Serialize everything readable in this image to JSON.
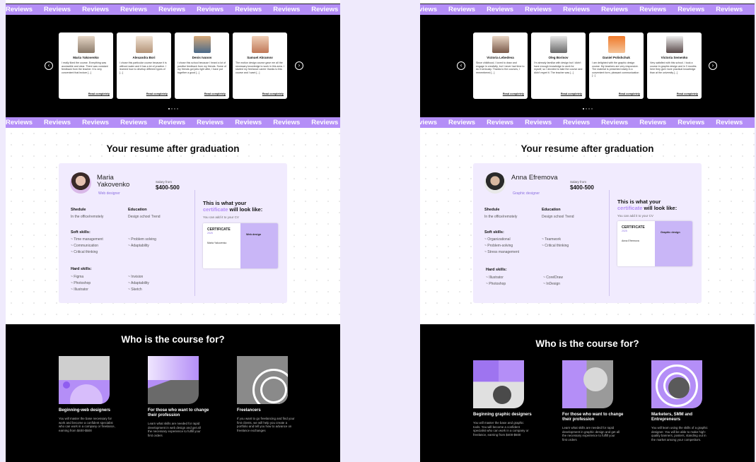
{
  "marquee": {
    "word": "Reviews",
    "left_count": 9,
    "right_count": 9
  },
  "colors": {
    "accent": "#b48ef7",
    "light_panel": "#f1ebfe",
    "dark": "#000000"
  },
  "left": {
    "reviews": [
      {
        "name": "Maria Yakovenko",
        "text": "I really liked the course. Everything was accessible and clear. There was constant feedback from the teacher. It is very convenient that lecture [...]",
        "read": "Read completely"
      },
      {
        "name": "Alexandra Bori",
        "text": "I chose this particular course because it is without water and it has a lot of practice. I learned how to develop different types of [...]",
        "read": "Read completely"
      },
      {
        "name": "Denis Ivanov",
        "text": "I chose this school because I heard a lot of positive feedback from my friends. Some of my friends got jobs right after, I have put together a good [...]",
        "read": "Read completely"
      },
      {
        "name": "Samuel Abramov",
        "text": "The motion design course gave me all the necessary knowledge to work in this area. I started my freelance career thanks to this course and I want [...]",
        "read": "Read completely"
      }
    ],
    "resume": {
      "title": "Your resume after graduation",
      "name": "Maria Yakovenko",
      "role": "Web designer",
      "salary_label": "Salary from",
      "salary": "$400-500",
      "schedule_label": "Shedule",
      "schedule": "In the office/remotely",
      "education_label": "Education",
      "education": "Design school Trend",
      "soft_label": "Soft skills:",
      "soft_col1": [
        "~ Time management",
        "~ Communication",
        "~ Critical thinking"
      ],
      "soft_col2": [
        "~ Problem solving",
        "~ Adaptability"
      ],
      "hard_label": "Hard skills:",
      "hard_col1": [
        "~ Figma",
        "~ Photoshop",
        "~ Illustrator"
      ],
      "hard_col2": [
        "~ Invision",
        "~ Adaptability",
        "~ Sketch"
      ],
      "cert_head_1": "This is what your",
      "cert_head_acc": "certificate",
      "cert_head_2": "will look like:",
      "cert_sub": "You can add it to your CV",
      "cert_title": "CERTIFICATE",
      "cert_year": "2025",
      "cert_person": "Maria Yakovenko",
      "cert_course": "Web design"
    },
    "who": {
      "title": "Who is the course for?",
      "cols": [
        {
          "title": "Beginning-web designers",
          "desc": "You will master the base necessary for work and become a confident specialist who can work in a company or freelance, earning from $400-$500"
        },
        {
          "title": "For those who want to change their profession",
          "desc": "Learn what skills are needed for rapid development in web design and get all the necessary experience to fulfill your first orders"
        },
        {
          "title": "Freelancers",
          "desc": "If you want to go freelancing and find your first clients, we will help you create a portfolio and tell you how to advance on freelance exchanges"
        }
      ]
    }
  },
  "right": {
    "reviews": [
      {
        "name": "Victoria Lebedeva",
        "text": "Since childhood, I loved to draw and engage in creativity, but I never had time to do it seriously. Thanks to the courses, I remembered [...]",
        "read": "Read completely"
      },
      {
        "name": "Oleg Borisov",
        "text": "I'm already familiar with design but I didn't have enough knowledge to work for myself, so I decided to take the course and didn't regret it. The teacher was [...]",
        "read": "Read completely"
      },
      {
        "name": "Daniel Polishchuk",
        "text": "I am delighted with the graphic design course. My teachers are very responsive. The material is presented easily in a convenient form, pleasant communication [...]",
        "read": "Read completely"
      },
      {
        "name": "Victoria Semenko",
        "text": "Very satisfied with this school. I took a course in graphic design and in 3 months here they give more practical knowledge than at the university [...]",
        "read": "Read completely"
      }
    ],
    "resume": {
      "title": "Your resume after graduation",
      "name": "Anna Efremova",
      "role": "Graphic designer",
      "salary_label": "Salary from",
      "salary": "$400-500",
      "schedule_label": "Shedule",
      "schedule": "In the office/remotely",
      "education_label": "Education",
      "education": "Design school Trend",
      "soft_label": "Soft skills:",
      "soft_col1": [
        "~ Organizational",
        "~ Problem-solving",
        "~ Stress management"
      ],
      "soft_col2": [
        "~ Teamwork",
        "~ Critical thinking"
      ],
      "hard_label": "Hard skills:",
      "hard_col1": [
        "~ Illustrator",
        "~ Photoshop"
      ],
      "hard_col2": [
        "~ CorelDraw",
        "~ InDesign"
      ],
      "cert_head_1": "This is what your",
      "cert_head_acc": "certificate",
      "cert_head_2": "will look like:",
      "cert_sub": "You can add it to your CV",
      "cert_title": "CERTIFICATE",
      "cert_year": "2025",
      "cert_person": "Anna Efremova",
      "cert_course": "Graphic design"
    },
    "who": {
      "title": "Who is the course for?",
      "cols": [
        {
          "title": "Beginning graphic designers",
          "desc": "You will master the base and graphic tools. You will become a confident specialist who can work in a company or freelance, earning from $400-$500"
        },
        {
          "title": "For those who want to change their profession",
          "desc": "Learn what skills are needed for rapid development in graphic design and get all the necessary experience to fulfill your first orders"
        },
        {
          "title": "Marketers, SMM and Entrepreneurs",
          "desc": "You will learn using the skills of a graphic designer. You will be able to make high-quality banners, posters, standing out in the market among your competitors."
        }
      ]
    }
  }
}
